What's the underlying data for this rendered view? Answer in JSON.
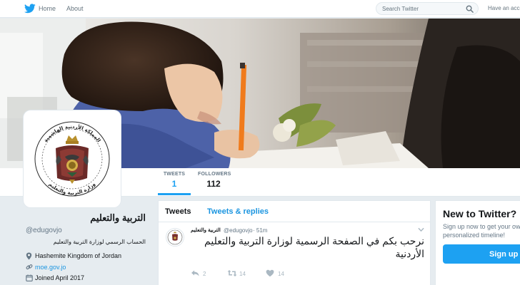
{
  "nav": {
    "home_label": "Home",
    "about_label": "About",
    "search_placeholder": "Search Twitter",
    "have_account_label": "Have an acco"
  },
  "profile": {
    "name": "التربية والتعليم",
    "handle": "@edugovjo",
    "bio": "الحساب الرسمي لوزارة التربية والتعليم",
    "location": "Hashemite Kingdom of Jordan",
    "url": "moe.gov.jo",
    "joined": "Joined April 2017"
  },
  "stats": {
    "tweets_label": "TWEETS",
    "tweets_count": "1",
    "following_label": "FOLLOWERS",
    "following_count": "112"
  },
  "timeline": {
    "tabs": [
      "Tweets",
      "Tweets & replies"
    ],
    "tweet": {
      "name": "التربية والتعليم",
      "handle": "@edugovjo",
      "time": "· 51m",
      "text": "نرحب بكم في الصفحة الرسمية لوزارة التربية والتعليم الأردنية",
      "replies": "2",
      "retweets": "14",
      "likes": "14"
    }
  },
  "signup": {
    "title": "New to Twitter?",
    "text": "Sign up now to get your own personalized timeline!",
    "button_label": "Sign up"
  },
  "colors": {
    "brand": "#1da1f2",
    "link": "#1b95e0",
    "page_bg": "#e6ecf0"
  },
  "icons": [
    "twitter-bird-icon",
    "search-icon",
    "location-pin-icon",
    "link-icon",
    "calendar-icon",
    "chevron-down-icon",
    "reply-icon",
    "retweet-icon",
    "heart-icon"
  ]
}
